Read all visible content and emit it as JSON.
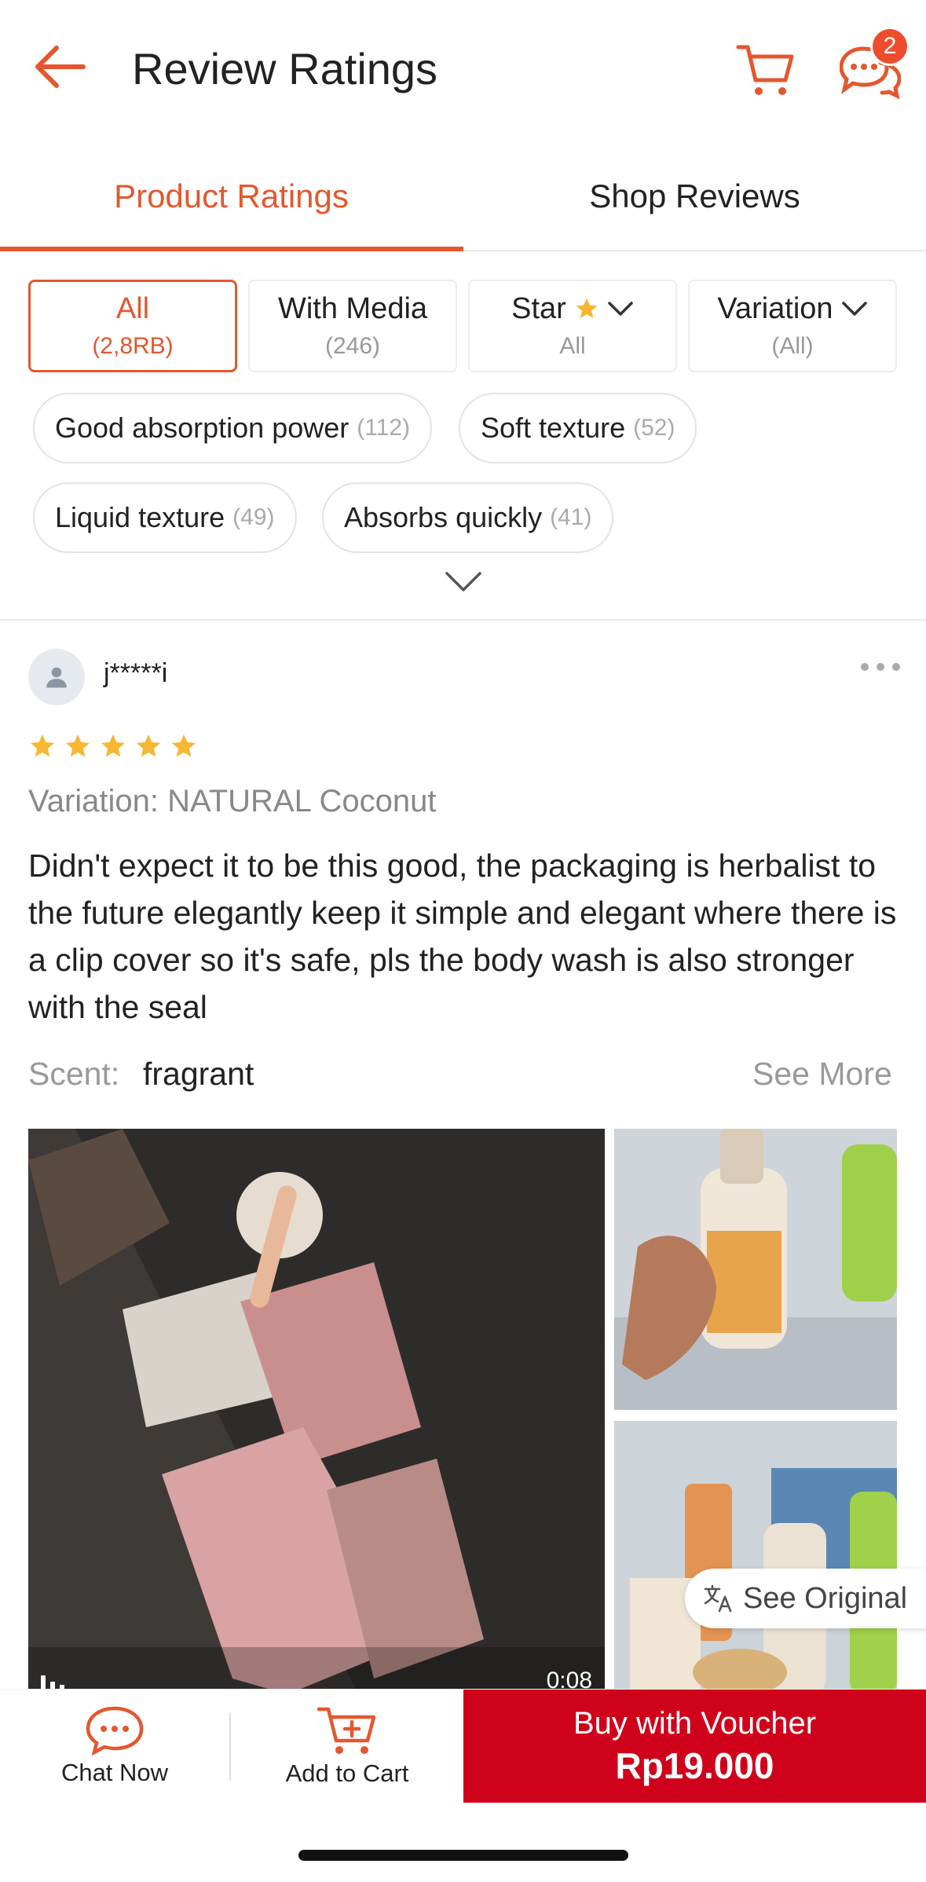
{
  "header": {
    "title": "Review Ratings",
    "chat_badge": "2"
  },
  "tabs": [
    {
      "label": "Product Ratings",
      "active": true
    },
    {
      "label": "Shop Reviews",
      "active": false
    }
  ],
  "filters": {
    "boxes": [
      {
        "label": "All",
        "sub": "(2,8RB)",
        "active": true
      },
      {
        "label": "With Media",
        "sub": "(246)"
      },
      {
        "label": "Star",
        "sub": "All"
      },
      {
        "label": "Variation",
        "sub": "(All)"
      }
    ],
    "chips": [
      {
        "label": "Good absorption power",
        "count": "(112)"
      },
      {
        "label": "Soft texture",
        "count": "(52)"
      },
      {
        "label": "Liquid texture",
        "count": "(49)"
      },
      {
        "label": "Absorbs quickly",
        "count": "(41)"
      }
    ]
  },
  "review": {
    "username": "j*****i",
    "rating": 5,
    "variation": "Variation: NATURAL Coconut",
    "text": "Didn't expect it to be this good, the packaging is herbalist to the future elegantly keep it simple and elegant where there is a clip cover so it's safe, pls the body wash is also stronger with the seal",
    "scent_label": "Scent:",
    "scent_value": "fragrant",
    "see_more": "See More",
    "video_duration": "0:08",
    "see_original": "See Original"
  },
  "bottom_bar": {
    "chat_label": "Chat Now",
    "cart_label": "Add to Cart",
    "buy_line1": "Buy with Voucher",
    "buy_line2": "Rp19.000"
  },
  "colors": {
    "accent": "#e4572e",
    "buy_button": "#d0011b",
    "star": "#f7b733"
  }
}
